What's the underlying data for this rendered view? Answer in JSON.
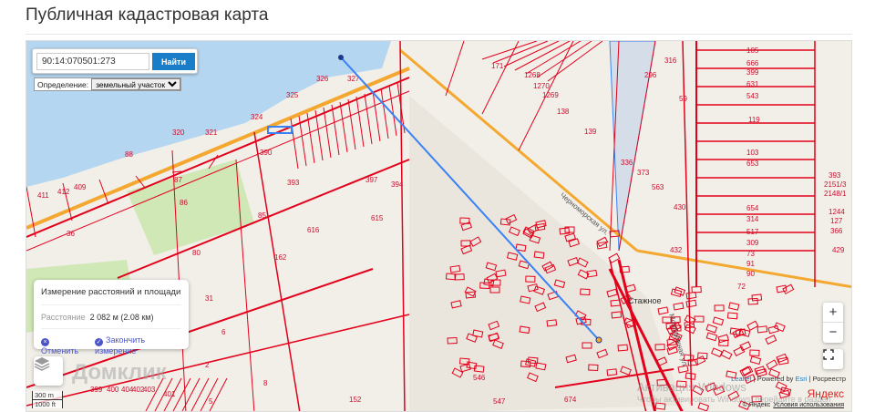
{
  "page_title": "Публичная кадастровая карта",
  "search": {
    "value": "90:14:070501:273",
    "button": "Найти"
  },
  "definition": {
    "label": "Определение:",
    "selected": "земельный участок"
  },
  "measure": {
    "title": "Измерение расстояний и площади",
    "distance_label": "Расстояние",
    "distance_value": "2 082 м (2.08 км)",
    "cancel": "Отменить",
    "finish": "Закончить измерение"
  },
  "scale": {
    "metric": "300 m",
    "imperial": "1000 ft"
  },
  "zoom": {
    "in": "+",
    "out": "−"
  },
  "attribution": {
    "leaflet": "Leaflet",
    "powered": "Powered by",
    "esri": "Esri",
    "rosreestr": "Росреестр"
  },
  "watermark": "Домклик",
  "windows": {
    "line1": "Активация Windows",
    "line2": "Чтобы активировать Windows, перейдите в раздел"
  },
  "yandex": {
    "logo": "Яндекс",
    "copy": "© Яндекс",
    "terms": "Условия использования"
  },
  "place_labels": [
    "Стажное",
    "Молодёжная ул.",
    "Черноморская ул."
  ],
  "parcels": [
    "325",
    "326",
    "327",
    "320",
    "321",
    "324",
    "88",
    "87",
    "86",
    "36",
    "80",
    "31",
    "393",
    "397",
    "394",
    "616",
    "615",
    "85",
    "162",
    "390",
    "171",
    "1268",
    "1270",
    "1269",
    "138",
    "139",
    "336",
    "373",
    "563",
    "430",
    "432",
    "59",
    "296",
    "316",
    "105",
    "666",
    "399",
    "631",
    "543",
    "119",
    "103",
    "653",
    "393",
    "2151/3",
    "2148/1",
    "654",
    "314",
    "517",
    "309",
    "73",
    "91",
    "90",
    "72",
    "1244",
    "127",
    "366",
    "429",
    "6",
    "2",
    "5",
    "8",
    "152",
    "547",
    "674",
    "546",
    "411",
    "412",
    "409",
    "399",
    "400",
    "404",
    "402",
    "403",
    "401"
  ],
  "colors": {
    "water": "#b5d6f0",
    "parcel": "#e3001b",
    "road": "#f4a830",
    "measure": "#3b82f6",
    "green": "#cfe8b5"
  }
}
